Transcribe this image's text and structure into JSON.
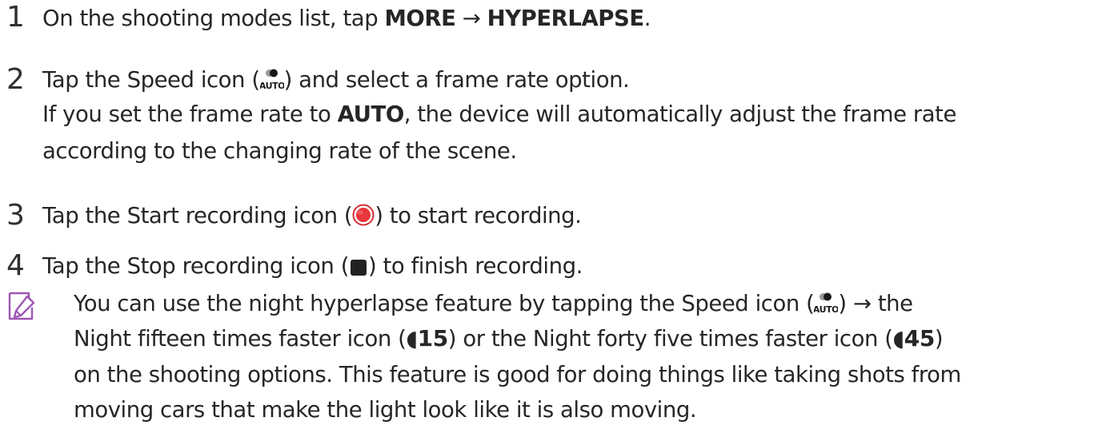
{
  "steps": [
    {
      "number": "1",
      "prefix": "On the shooting modes list, tap ",
      "more": "MORE",
      "arrow": " → ",
      "hyperlapse": "HYPERLAPSE",
      "suffix": "."
    },
    {
      "number": "2",
      "line1_prefix": "Tap the Speed icon (",
      "line1_suffix": ") and select a frame rate option.",
      "line2_prefix": "If you set the frame rate to ",
      "auto": "AUTO",
      "line2_suffix": ", the device will automatically adjust the frame rate",
      "line3": "according to the changing rate of the scene."
    },
    {
      "number": "3",
      "prefix": "Tap the Start recording icon (",
      "suffix": ") to start recording."
    },
    {
      "number": "4",
      "prefix": "Tap the Stop recording icon (",
      "suffix": ") to finish recording."
    }
  ],
  "note": {
    "line1_prefix": "You can use the night hyperlapse feature by tapping the Speed icon (",
    "line1_suffix": ") → the",
    "line2_prefix": "Night fifteen times faster icon (",
    "night15": "◖15",
    "line2_middle": ") or the Night forty five times faster icon (",
    "night45": "◖45",
    "line2_suffix": ")",
    "line3": "on the shooting options. This feature is good for doing things like taking shots from",
    "line4": "moving cars that make the light look like it is also moving."
  },
  "icons": {
    "speed": "speed-auto-icon",
    "record": "start-recording-icon",
    "stop": "stop-recording-icon",
    "night15": "night-15x-icon",
    "night45": "night-45x-icon",
    "note": "note-pencil-icon"
  },
  "colors": {
    "text": "#262626",
    "record_red": "#e8363a",
    "record_ring": "#d23035",
    "stop_fill": "#222222"
  },
  "speed_icon_label": "AUTO"
}
